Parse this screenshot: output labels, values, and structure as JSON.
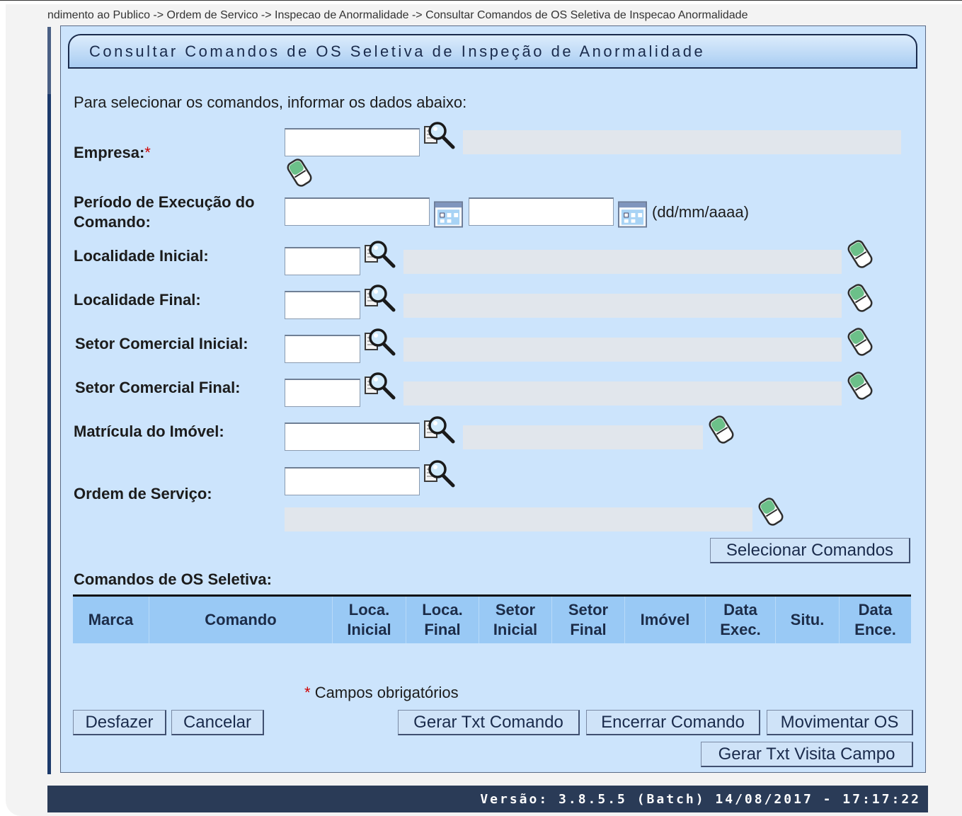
{
  "breadcrumb": "ndimento ao Publico -> Ordem de Servico -> Inspecao de Anormalidade -> Consultar Comandos de OS Seletiva de Inspecao Anormalidade",
  "title": "Consultar Comandos de OS Seletiva de Inspeção de Anormalidade",
  "intro": "Para selecionar os comandos, informar os dados abaixo:",
  "fields": {
    "empresa": "Empresa:",
    "required_mark": "*",
    "periodo_line1": "Período de Execução do",
    "periodo_line2": "Comando:",
    "date_format": "(dd/mm/aaaa)",
    "localidade_inicial": "Localidade Inicial:",
    "localidade_final": "Localidade Final:",
    "setor_inicial": "Setor Comercial Inicial:",
    "setor_final": "Setor Comercial Final:",
    "matricula": "Matrícula do Imóvel:",
    "ordem_servico": "Ordem de Serviço:"
  },
  "select_button": "Selecionar Comandos",
  "section_title": "Comandos de OS Seletiva:",
  "table_headers": [
    {
      "l1": "Marca",
      "l2": ""
    },
    {
      "l1": "Comando",
      "l2": ""
    },
    {
      "l1": "Loca.",
      "l2": "Inicial"
    },
    {
      "l1": "Loca.",
      "l2": "Final"
    },
    {
      "l1": "Setor",
      "l2": "Inicial"
    },
    {
      "l1": "Setor",
      "l2": "Final"
    },
    {
      "l1": "Imóvel",
      "l2": ""
    },
    {
      "l1": "Data",
      "l2": "Exec."
    },
    {
      "l1": "Situ.",
      "l2": ""
    },
    {
      "l1": "Data",
      "l2": "Ence."
    }
  ],
  "required_note": "Campos obrigatórios",
  "buttons": {
    "desfazer": "Desfazer",
    "cancelar": "Cancelar",
    "gerar_txt_comando": "Gerar Txt Comando",
    "encerrar_comando": "Encerrar Comando",
    "movimentar_os": "Movimentar OS",
    "gerar_txt_visita": "Gerar Txt Visita Campo"
  },
  "footer": "Versão: 3.8.5.5 (Batch) 14/08/2017 - 17:17:22",
  "colors": {
    "panel": "#cce4fc",
    "header": "#99c9f5",
    "footer": "#2a3b57",
    "required": "#d00000"
  },
  "icons": [
    "search-icon",
    "eraser-icon",
    "calendar-icon"
  ]
}
